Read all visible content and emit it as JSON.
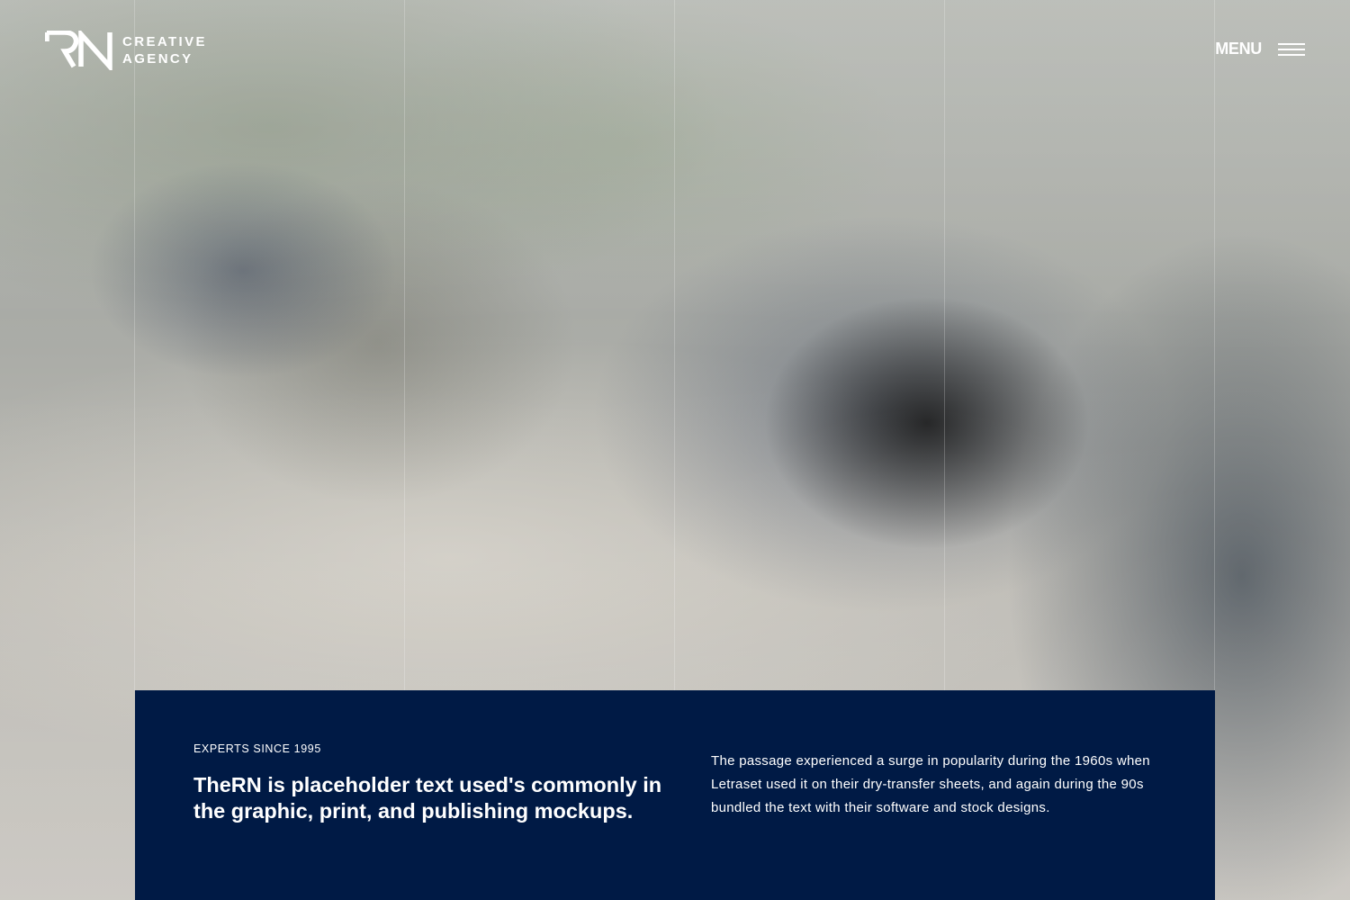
{
  "brand": {
    "line1": "CREATIVE",
    "line2": "AGENCY",
    "logo_icon": "rn-monogram-logo"
  },
  "header": {
    "menu_label": "MENU",
    "menu_icon": "hamburger-icon"
  },
  "hero": {
    "background": "blurred-office-photo"
  },
  "intro": {
    "eyebrow": "EXPERTS SINCE 1995",
    "headline": "TheRN is placeholder text used's commonly in the graphic, print, and publishing mockups.",
    "body": "The passage experienced a surge in popularity during the 1960s when Letraset used it on their dry-transfer sheets, and again during the 90s bundled the text with their software and stock designs."
  },
  "colors": {
    "panel_bg": "#001a45",
    "text": "#ffffff"
  }
}
